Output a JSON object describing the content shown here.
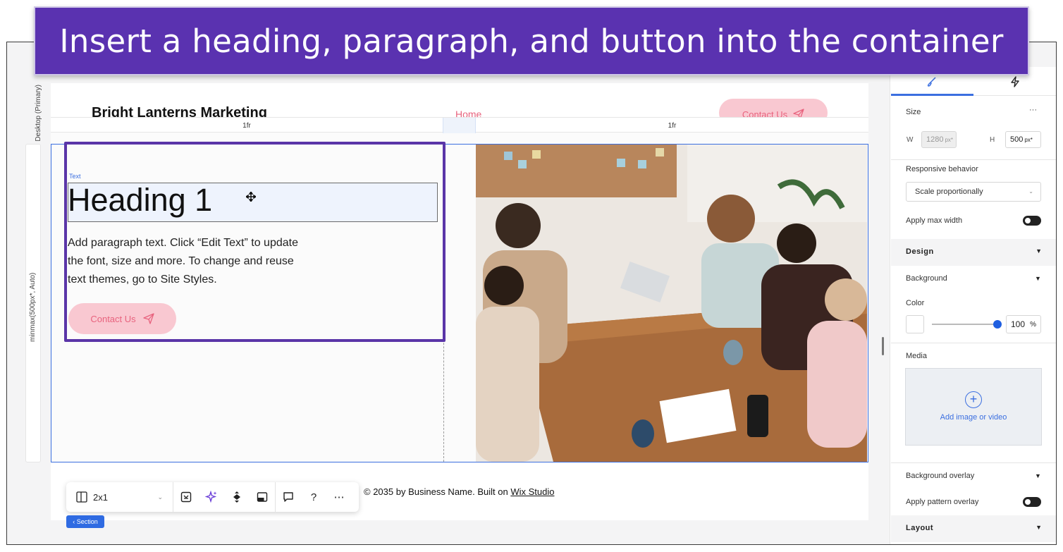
{
  "banner": {
    "title": "Insert a heading, paragraph, and button into the container"
  },
  "left_rail": {
    "breakpoint_label": "Desktop (Primary)",
    "row_size_label": "minmax(500px*, Auto)"
  },
  "site_header": {
    "brand": "Bright Lanterns Marketing",
    "nav_home": "Home",
    "contact_button": "Contact Us"
  },
  "grid": {
    "col1_label": "1fr",
    "col2_label": "1fr"
  },
  "content": {
    "element_tag": "Text",
    "heading": "Heading 1",
    "paragraph": "Add paragraph text. Click “Edit Text” to update the font, size and more. To change and reuse text themes, go to Site Styles.",
    "button_label": "Contact Us"
  },
  "footer": {
    "copyright_prefix": "© 2035 by Business Name. Built on ",
    "link_text": "Wix Studio"
  },
  "toolbar": {
    "layout_value": "2x1",
    "section_tag": "Section",
    "icons": [
      "layout-grid-icon",
      "fit-icon",
      "ai-sparkle-icon",
      "arrange-icon",
      "background-icon",
      "comment-icon",
      "help-icon",
      "more-icon"
    ]
  },
  "panel": {
    "size_label": "Size",
    "more_label": "···",
    "w_label": "W",
    "w_value": "1280",
    "w_unit": "px*",
    "h_label": "H",
    "h_value": "500",
    "h_unit": "px*",
    "responsive_label": "Responsive behavior",
    "responsive_value": "Scale proportionally",
    "max_width_label": "Apply max width",
    "design_label": "Design",
    "background_label": "Background",
    "color_label": "Color",
    "opacity_value": "100",
    "opacity_unit": "%",
    "media_label": "Media",
    "media_add": "Add image or video",
    "overlay_label": "Background overlay",
    "pattern_label": "Apply pattern overlay",
    "layout_label": "Layout"
  },
  "colors": {
    "banner_bg": "#5a32b0",
    "accent_blue": "#3b6fe0",
    "button_pink": "#f9c8d1",
    "button_text": "#e8637e",
    "highlight_purple": "#5a35a8"
  }
}
